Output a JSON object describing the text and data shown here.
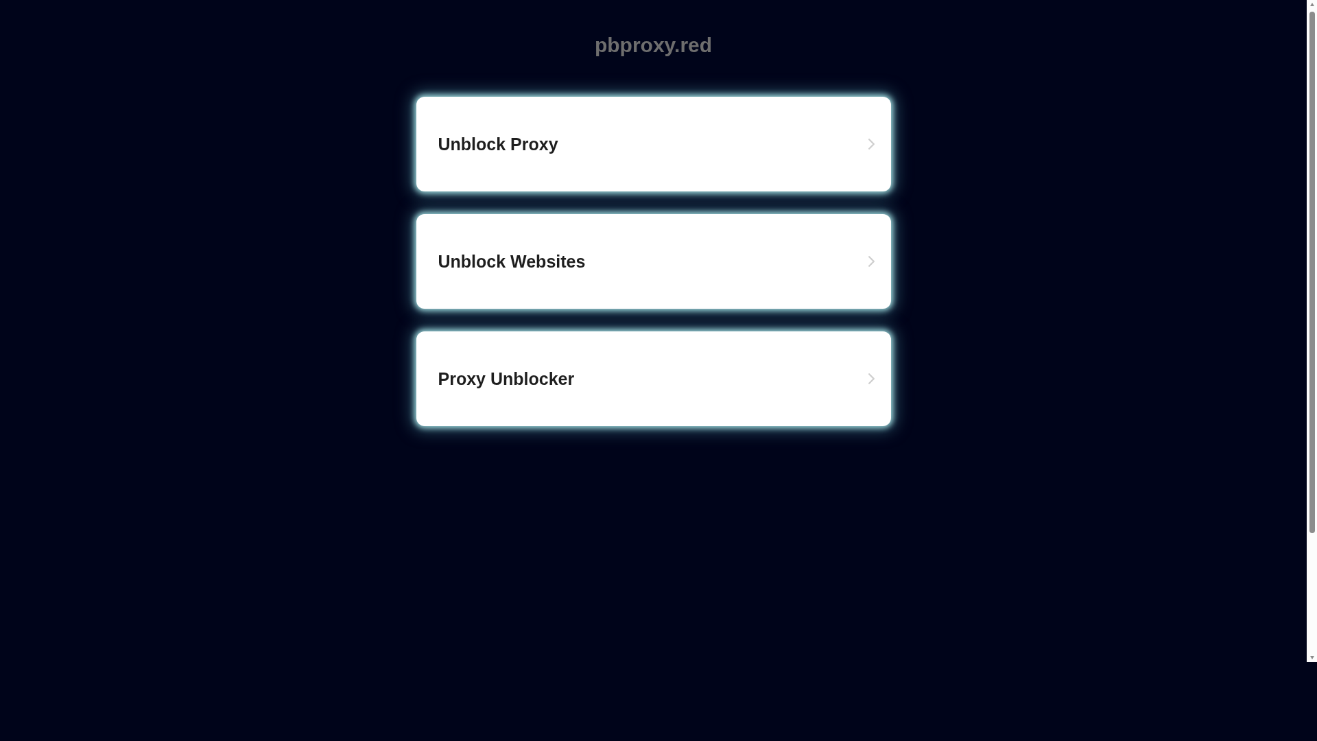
{
  "site_title": "pbproxy.red",
  "links": [
    {
      "label": "Unblock Proxy"
    },
    {
      "label": "Unblock Websites"
    },
    {
      "label": "Proxy Unblocker"
    }
  ]
}
